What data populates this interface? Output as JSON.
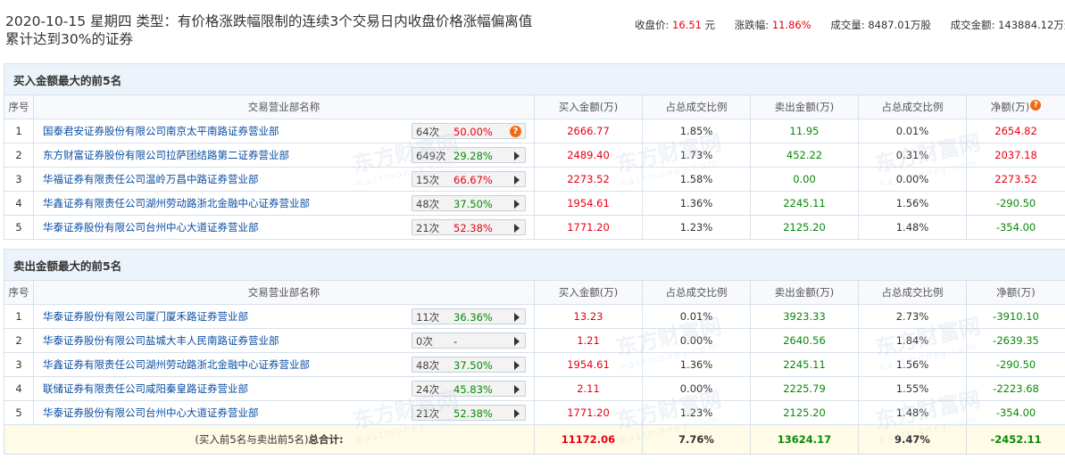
{
  "header": {
    "title": "2020-10-15 星期四  类型：有价格涨跌幅限制的连续3个交易日内收盘价格涨幅偏离值累计达到30%的证券",
    "close_label": "收盘价:",
    "close_value": "16.51",
    "close_unit": "元",
    "change_label": "涨跌幅:",
    "change_value": "11.86%",
    "volume_label": "成交量:",
    "volume_value": "8487.01万股",
    "amount_label": "成交金额:",
    "amount_value": "143884.12万元"
  },
  "columns": [
    "序号",
    "交易营业部名称",
    "买入金额(万)",
    "占总成交比例",
    "卖出金额(万)",
    "占总成交比例",
    "净额(万)"
  ],
  "buy": {
    "title": "买入金额最大的前5名",
    "rows": [
      {
        "no": "1",
        "name": "国泰君安证券股份有限公司南京太平南路证券营业部",
        "times": "64次",
        "pct": "50.00%",
        "pct_color": "red",
        "action": "question",
        "buy": "2666.77",
        "buy_ratio": "1.85%",
        "sell": "11.95",
        "sell_ratio": "0.01%",
        "net": "2654.82",
        "net_color": "red"
      },
      {
        "no": "2",
        "name": "东方财富证券股份有限公司拉萨团结路第二证券营业部",
        "times": "649次",
        "pct": "29.28%",
        "pct_color": "green",
        "action": "arrow",
        "buy": "2489.40",
        "buy_ratio": "1.73%",
        "sell": "452.22",
        "sell_ratio": "0.31%",
        "net": "2037.18",
        "net_color": "red"
      },
      {
        "no": "3",
        "name": "华福证券有限责任公司温岭万昌中路证券营业部",
        "times": "15次",
        "pct": "66.67%",
        "pct_color": "red",
        "action": "arrow",
        "buy": "2273.52",
        "buy_ratio": "1.58%",
        "sell": "0.00",
        "sell_ratio": "0.00%",
        "net": "2273.52",
        "net_color": "red"
      },
      {
        "no": "4",
        "name": "华鑫证券有限责任公司湖州劳动路浙北金融中心证券营业部",
        "times": "48次",
        "pct": "37.50%",
        "pct_color": "green",
        "action": "arrow",
        "buy": "1954.61",
        "buy_ratio": "1.36%",
        "sell": "2245.11",
        "sell_ratio": "1.56%",
        "net": "-290.50",
        "net_color": "green"
      },
      {
        "no": "5",
        "name": "华泰证券股份有限公司台州中心大道证券营业部",
        "times": "21次",
        "pct": "52.38%",
        "pct_color": "red",
        "action": "arrow",
        "buy": "1771.20",
        "buy_ratio": "1.23%",
        "sell": "2125.20",
        "sell_ratio": "1.48%",
        "net": "-354.00",
        "net_color": "green"
      }
    ]
  },
  "sell": {
    "title": "卖出金额最大的前5名",
    "rows": [
      {
        "no": "1",
        "name": "华泰证券股份有限公司厦门厦禾路证券营业部",
        "times": "11次",
        "pct": "36.36%",
        "pct_color": "green",
        "action": "arrow",
        "buy": "13.23",
        "buy_ratio": "0.01%",
        "sell": "3923.33",
        "sell_ratio": "2.73%",
        "net": "-3910.10",
        "net_color": "green"
      },
      {
        "no": "2",
        "name": "华泰证券股份有限公司盐城大丰人民南路证券营业部",
        "times": "0次",
        "pct": "-",
        "pct_color": "plain",
        "action": "arrow",
        "buy": "1.21",
        "buy_ratio": "0.00%",
        "sell": "2640.56",
        "sell_ratio": "1.84%",
        "net": "-2639.35",
        "net_color": "green"
      },
      {
        "no": "3",
        "name": "华鑫证券有限责任公司湖州劳动路浙北金融中心证券营业部",
        "times": "48次",
        "pct": "37.50%",
        "pct_color": "green",
        "action": "arrow",
        "buy": "1954.61",
        "buy_ratio": "1.36%",
        "sell": "2245.11",
        "sell_ratio": "1.56%",
        "net": "-290.50",
        "net_color": "green"
      },
      {
        "no": "4",
        "name": "联储证券有限责任公司咸阳秦皇路证券营业部",
        "times": "24次",
        "pct": "45.83%",
        "pct_color": "green",
        "action": "arrow",
        "buy": "2.11",
        "buy_ratio": "0.00%",
        "sell": "2225.79",
        "sell_ratio": "1.55%",
        "net": "-2223.68",
        "net_color": "green"
      },
      {
        "no": "5",
        "name": "华泰证券股份有限公司台州中心大道证券营业部",
        "times": "21次",
        "pct": "52.38%",
        "pct_color": "green",
        "action": "arrow",
        "buy": "1771.20",
        "buy_ratio": "1.23%",
        "sell": "2125.20",
        "sell_ratio": "1.48%",
        "net": "-354.00",
        "net_color": "green"
      }
    ]
  },
  "total": {
    "label_prefix": "(买入前5名与卖出前5名)",
    "label_bold": "总合计:",
    "buy": "11172.06",
    "buy_ratio": "7.76%",
    "sell": "13624.17",
    "sell_ratio": "9.47%",
    "net": "-2452.11"
  },
  "watermark": {
    "cn": "东方财富网",
    "en": "eastmoney.com"
  },
  "icons": {
    "question": "question-icon",
    "arrow": "play-arrow-icon"
  },
  "colors": {
    "up": "#e60012",
    "down": "#078a07",
    "link": "#0b4ea2",
    "section_bg": "#edf3fa",
    "total_bg": "#fffbe6",
    "question": "#f26a10"
  }
}
